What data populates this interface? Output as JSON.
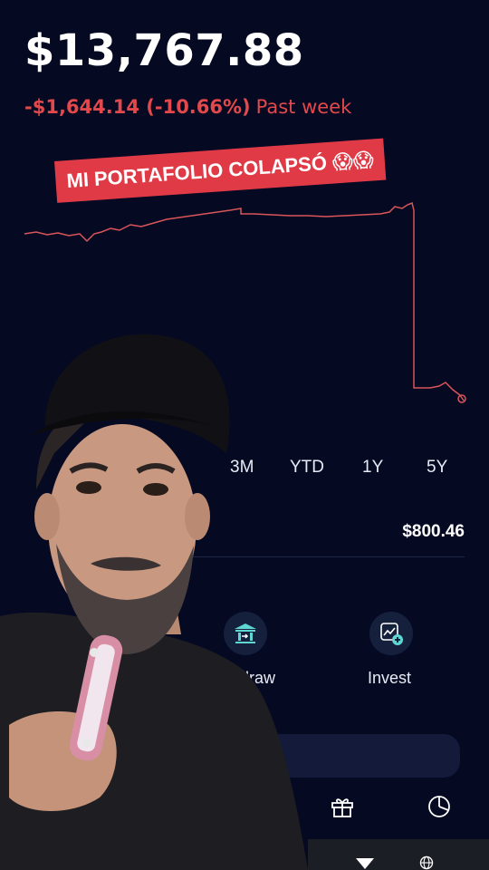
{
  "portfolio": {
    "balance": "$13,767.88",
    "change_amount": "-$1,644.14 (-10.66%)",
    "change_period": "Past week"
  },
  "caption": {
    "text": "MI PORTAFOLIO COLAPSÓ",
    "emojis": "😱😱"
  },
  "time_ranges": [
    "3M",
    "YTD",
    "1Y",
    "5Y"
  ],
  "summary": {
    "value": "$800.46"
  },
  "actions": {
    "withdraw_label": "hdraw",
    "invest_label": "Invest"
  },
  "colors": {
    "background": "#050a22",
    "negative": "#e2484c",
    "caption_bg": "#e03a47",
    "icon_accent": "#5fd6d2"
  },
  "icons": [
    "bank-icon",
    "invest-chart-icon",
    "gift-icon",
    "pie-chart-icon",
    "signal-icon",
    "globe-icon"
  ]
}
